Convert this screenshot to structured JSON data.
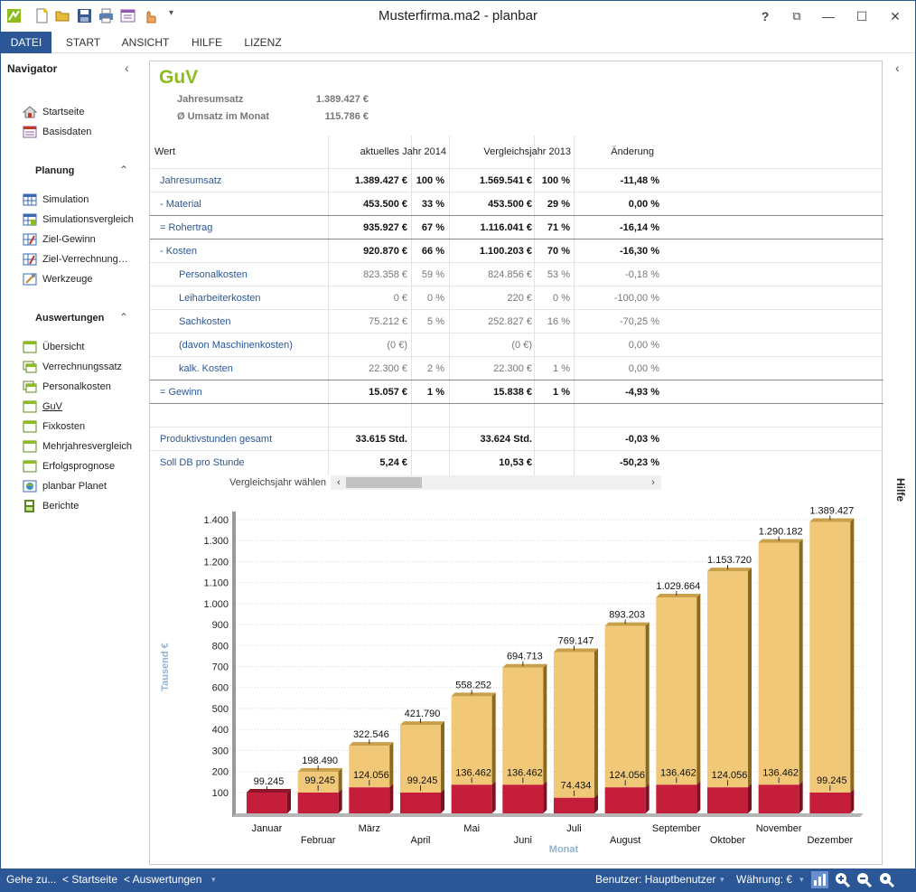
{
  "window": {
    "title": "Musterfirma.ma2 - planbar",
    "help": "?",
    "restore": "⧉",
    "minimize": "—",
    "maximize": "☐",
    "close": "✕"
  },
  "ribbon": {
    "tabs": [
      "DATEI",
      "START",
      "ANSICHT",
      "HILFE",
      "LIZENZ"
    ],
    "active": "DATEI"
  },
  "navigator": {
    "title": "Navigator",
    "top_items": [
      {
        "label": "Startseite",
        "icon": "house-icon"
      },
      {
        "label": "Basisdaten",
        "icon": "basisdaten-icon"
      }
    ],
    "planung": {
      "title": "Planung",
      "items": [
        {
          "label": "Simulation",
          "icon": "grid-icon"
        },
        {
          "label": "Simulationsvergleich",
          "icon": "grid-compare-icon"
        },
        {
          "label": "Ziel-Gewinn",
          "icon": "target-grid-icon"
        },
        {
          "label": "Ziel-Verrechnung…",
          "icon": "target-grid-icon"
        },
        {
          "label": "Werkzeuge",
          "icon": "tools-icon"
        }
      ]
    },
    "auswertungen": {
      "title": "Auswertungen",
      "items": [
        {
          "label": "Übersicht",
          "icon": "report-icon"
        },
        {
          "label": "Verrechnungssatz",
          "icon": "report-stack-icon"
        },
        {
          "label": "Personalkosten",
          "icon": "report-stack-icon"
        },
        {
          "label": "GuV",
          "icon": "report-icon"
        },
        {
          "label": "Fixkosten",
          "icon": "report-icon"
        },
        {
          "label": "Mehrjahresvergleich",
          "icon": "report-icon"
        },
        {
          "label": "Erfolgsprognose",
          "icon": "report-icon"
        },
        {
          "label": "planbar Planet",
          "icon": "globe-icon"
        },
        {
          "label": "Berichte",
          "icon": "berichte-icon"
        }
      ]
    }
  },
  "guv": {
    "title": "GuV",
    "summary": [
      {
        "label": "Jahresumsatz",
        "value": "1.389.427 €"
      },
      {
        "label": "Ø Umsatz im Monat",
        "value": "115.786 €"
      }
    ],
    "headers": {
      "wert": "Wert",
      "current": "aktuelles Jahr 2014",
      "compare": "Vergleichsjahr 2013",
      "change": "Änderung"
    },
    "rows": [
      {
        "label": "Jahresumsatz",
        "indent": false,
        "bold": true,
        "sep": false,
        "v1": "1.389.427 €",
        "p1": "100 %",
        "v2": "1.569.541 €",
        "p2": "100 %",
        "chg": "-11,48 %"
      },
      {
        "label": "- Material",
        "indent": false,
        "bold": true,
        "sep": false,
        "v1": "453.500 €",
        "p1": "33 %",
        "v2": "453.500 €",
        "p2": "29 %",
        "chg": "0,00 %"
      },
      {
        "label": "= Rohertrag",
        "indent": false,
        "bold": true,
        "sep": true,
        "v1": "935.927 €",
        "p1": "67 %",
        "v2": "1.116.041 €",
        "p2": "71 %",
        "chg": "-16,14 %"
      },
      {
        "label": "- Kosten",
        "indent": false,
        "bold": true,
        "sep": true,
        "v1": "920.870 €",
        "p1": "66 %",
        "v2": "1.100.203 €",
        "p2": "70 %",
        "chg": "-16,30 %"
      },
      {
        "label": "Personalkosten",
        "indent": true,
        "bold": false,
        "sep": false,
        "v1": "823.358 €",
        "p1": "59 %",
        "v2": "824.856 €",
        "p2": "53 %",
        "chg": "-0,18 %"
      },
      {
        "label": "Leiharbeiterkosten",
        "indent": true,
        "bold": false,
        "sep": false,
        "v1": "0 €",
        "p1": "0 %",
        "v2": "220 €",
        "p2": "0 %",
        "chg": "-100,00 %"
      },
      {
        "label": "Sachkosten",
        "indent": true,
        "bold": false,
        "sep": false,
        "v1": "75.212 €",
        "p1": "5 %",
        "v2": "252.827 €",
        "p2": "16 %",
        "chg": "-70,25 %"
      },
      {
        "label": "(davon Maschinenkosten)",
        "indent": true,
        "bold": false,
        "sep": false,
        "v1": "(0 €)",
        "p1": "",
        "v2": "(0 €)",
        "p2": "",
        "chg": "0,00 %"
      },
      {
        "label": "kalk. Kosten",
        "indent": true,
        "bold": false,
        "sep": false,
        "v1": "22.300 €",
        "p1": "2 %",
        "v2": "22.300 €",
        "p2": "1 %",
        "chg": "0,00 %"
      },
      {
        "label": "= Gewinn",
        "indent": false,
        "bold": true,
        "sep": true,
        "v1": "15.057 €",
        "p1": "1 %",
        "v2": "15.838 €",
        "p2": "1 %",
        "chg": "-4,93 %"
      },
      {
        "label": "",
        "indent": false,
        "bold": false,
        "sep": true,
        "v1": "",
        "p1": "",
        "v2": "",
        "p2": "",
        "chg": ""
      },
      {
        "label": "Produktivstunden gesamt",
        "indent": false,
        "bold": true,
        "sep": false,
        "v1": "33.615 Std.",
        "p1": "",
        "v2": "33.624 Std.",
        "p2": "",
        "chg": "-0,03 %"
      },
      {
        "label": "Soll DB pro Stunde",
        "indent": false,
        "bold": true,
        "sep": false,
        "v1": "5,24 €",
        "p1": "",
        "v2": "10,53 €",
        "p2": "",
        "chg": "-50,23 %"
      }
    ],
    "compare_year_label": "Vergleichsjahr wählen"
  },
  "chart_data": {
    "type": "bar",
    "stacked": true,
    "categories": [
      "Januar",
      "Februar",
      "März",
      "April",
      "Mai",
      "Juni",
      "Juli",
      "August",
      "September",
      "Oktober",
      "November",
      "Dezember"
    ],
    "series": [
      {
        "values": [
          99.245,
          99.245,
          124.056,
          99.245,
          136.462,
          136.462,
          74.434,
          124.056,
          136.462,
          124.056,
          136.462,
          99.245
        ],
        "color": "#c41e3a"
      },
      {
        "values": [
          99.245,
          198.49,
          322.546,
          421.79,
          558.252,
          694.713,
          769.147,
          893.203,
          1029.664,
          1153.72,
          1290.182,
          1389.427
        ],
        "color": "#f0c878"
      }
    ],
    "bottom_labels": [
      "",
      "99.245",
      "124.056",
      "99.245",
      "136.462",
      "136.462",
      "74.434",
      "124.056",
      "136.462",
      "124.056",
      "136.462",
      "99.245"
    ],
    "top_labels": [
      "99.245",
      "198.490",
      "322.546",
      "421.790",
      "558.252",
      "694.713",
      "769.147",
      "893.203",
      "1.029.664",
      "1.153.720",
      "1.290.182",
      "1.389.427"
    ],
    "y_ticks": [
      "100",
      "200",
      "300",
      "400",
      "500",
      "600",
      "700",
      "800",
      "900",
      "1.000",
      "1.100",
      "1.200",
      "1.300",
      "1.400"
    ],
    "ylim": [
      0,
      1400
    ],
    "ylabel": "Tausend €",
    "xlabel": "Monat",
    "grid": true
  },
  "rightbar": {
    "label": "Hilfe"
  },
  "statusbar": {
    "goto": "Gehe zu...",
    "back1": "< Startseite",
    "back2": "< Auswertungen",
    "user": "Benutzer: Hauptbenutzer",
    "currency": "Währung: €"
  },
  "colors": {
    "accent": "#2b5797",
    "title_green": "#8cbd1c",
    "bar_red": "#c41e3a",
    "bar_gold": "#f0c878"
  }
}
